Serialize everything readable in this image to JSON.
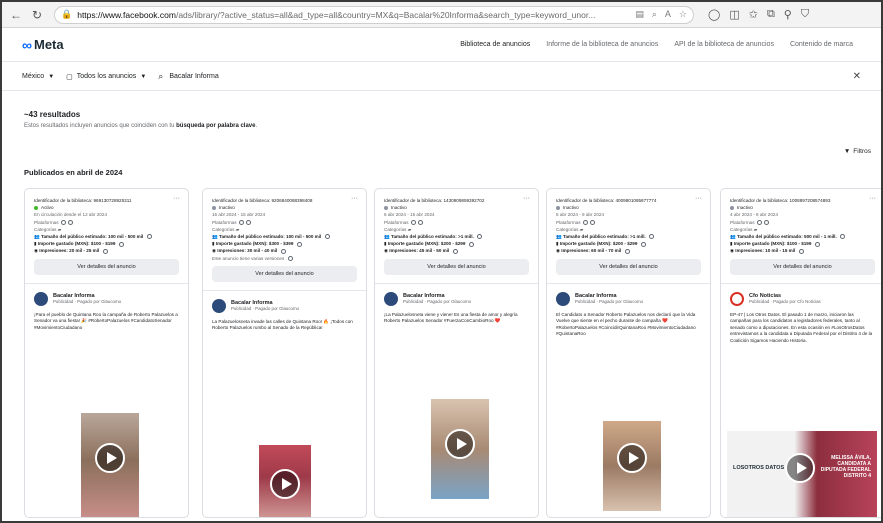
{
  "browser": {
    "url_host": "https://www.facebook.com",
    "url_path": "/ads/library/?active_status=all&ad_type=all&country=MX&q=Bacalar%20Informa&search_type=keyword_unor...",
    "icons": [
      "back-icon",
      "refresh-icon",
      "lock-icon",
      "reader-icon",
      "zoom-icon",
      "read-aloud-icon",
      "favorite-icon",
      "copilot-icon",
      "split-screen-icon",
      "favorites-bar-icon",
      "collections-icon",
      "extensions-icon",
      "shield-icon"
    ]
  },
  "topnav": {
    "logo_text": "Meta",
    "links": [
      "Biblioteca de anuncios",
      "Informe de la biblioteca de anuncios",
      "API de la biblioteca de anuncios",
      "Contenido de marca"
    ]
  },
  "filters": {
    "country": "México",
    "ad_type": "Todos los anuncios",
    "query": "Bacalar Informa"
  },
  "results": {
    "count_label": "~43 resultados",
    "subtitle_prefix": "Estos resultados incluyen anuncios que coinciden con tu",
    "subtitle_bold": "búsqueda por palabra clave",
    "subtitle_suffix": ".",
    "filters_button": "Filtros",
    "section_heading": "Publicados en abril de 2024"
  },
  "cards": [
    {
      "library_id": "Identificador de la biblioteca: 969130728925311",
      "status": "Activo",
      "status_active": true,
      "dates": "En circulación desde el 12 abr 2024",
      "platforms": "Plataformas",
      "categories": "Categorías",
      "audience": "Tamaño del público estimado:",
      "audience_value": "100 mil - 500 mil",
      "spend": "Importe gastado (MXN): $100 - $199",
      "impressions": "Impresiones: 20 mil - 25 mil",
      "note": "",
      "details_button": "Ver detalles del anuncio",
      "advertiser": "Bacalar Informa",
      "sponsor": "Publicidad · Pagado por Glaucomo",
      "body": "¡Para el pueblo de Quintana Roo la campaña de Roberto Palazuelos a Senador va una fiesta! 🎉 #RobertoPalazuelos #CandidatoSenador #MovimientoCiudadano"
    },
    {
      "library_id": "Identificador de la biblioteca: 9206840088398408",
      "status": "Inactivo",
      "status_active": false,
      "dates": "15 abr 2024 - 15 abr 2024",
      "platforms": "Plataformas",
      "categories": "Categorías",
      "audience": "Tamaño del público estimado:",
      "audience_value": "100 mil - 500 mil",
      "spend": "Importe gastado (MXN): $300 - $399",
      "impressions": "Impresiones: 30 mil - 40 mil",
      "note": "Este anuncio tiene varias versiones",
      "details_button": "Ver detalles del anuncio",
      "advertiser": "Bacalar Informa",
      "sponsor": "Publicidad · Pagado por Glaucomo",
      "body": "La Palazuelosneta invade las calles de Quintana Roo! 🔥 ¡Todos con Roberto Palazuelos rumbo al Senado de la República!"
    },
    {
      "library_id": "Identificador de la biblioteca: 1430909859392702",
      "status": "Inactivo",
      "status_active": false,
      "dates": "6 abr 2024 - 15 abr 2024",
      "platforms": "Plataformas",
      "categories": "Categorías",
      "audience": "Tamaño del público estimado: >1 mill.",
      "audience_value": "",
      "spend": "Importe gastado (MXN): $200 - $299",
      "impressions": "Impresiones: 45 mil - 50 mil",
      "note": "",
      "details_button": "Ver detalles del anuncio",
      "advertiser": "Bacalar Informa",
      "sponsor": "Publicidad · Pagado por Glaucomo",
      "body": "¡La Palazuelosneta viene y viene! Es una fiesta de amor y alegría Roberto Palazuelos Senador #FuerzaConCambioRoo ❤️"
    },
    {
      "library_id": "Identificador de la biblioteca: 4009801085877774",
      "status": "Inactivo",
      "status_active": false,
      "dates": "5 abr 2024 - 9 abr 2024",
      "platforms": "Plataformas",
      "categories": "Categorías",
      "audience": "Tamaño del público estimado: >1 mill.",
      "audience_value": "",
      "spend": "Importe gastado (MXN): $200 - $299",
      "impressions": "Impresiones: 60 mil - 70 mil",
      "note": "",
      "details_button": "Ver detalles del anuncio",
      "advertiser": "Bacalar Informa",
      "sponsor": "Publicidad · Pagado por Glaucomo",
      "body": "El Candidato a Senador Roberto Palazuelos nos declaró que la Vida Vuelve que siente en el pecho durante de campaña ❤️ #RobertoPalazuelos #CoincidirQuintanaRoo #MovimientoCiudadano #QuintanaRoo"
    },
    {
      "library_id": "Identificador de la biblioteca: 1008897208574893",
      "status": "Inactivo",
      "status_active": false,
      "dates": "4 abr 2024 - 8 abr 2024",
      "platforms": "Plataformas",
      "categories": "Categorías",
      "audience": "Tamaño del público estimado: 500 mil - 1 mill.",
      "audience_value": "",
      "spend": "Importe gastado (MXN): $100 - $199",
      "impressions": "Impresiones: 10 mil - 15 mil",
      "note": "",
      "details_button": "Ver detalles del anuncio",
      "advertiser": "Cfo Noticias",
      "sponsor": "Publicidad · Pagado por Cfo Noticias",
      "body": "EP-47 | Los Otros Datos. El pasado 1 de marzo, iniciaron las campañas para los candidatos a legisladores federales, tanto al senado como a diputaciones. En esta ocasión en #LosOtrosDatos entrevistamos a la candidata a Diputada Federal por el Distrito 4 de la Coalición Sigamos Haciendo Historia.",
      "video_logo": "LOSOTROS DATOS",
      "video_caption": "MELISSA ÁVILA, CANDIDATA A DIPUTADA FEDERAL DISTRITO 4"
    }
  ]
}
